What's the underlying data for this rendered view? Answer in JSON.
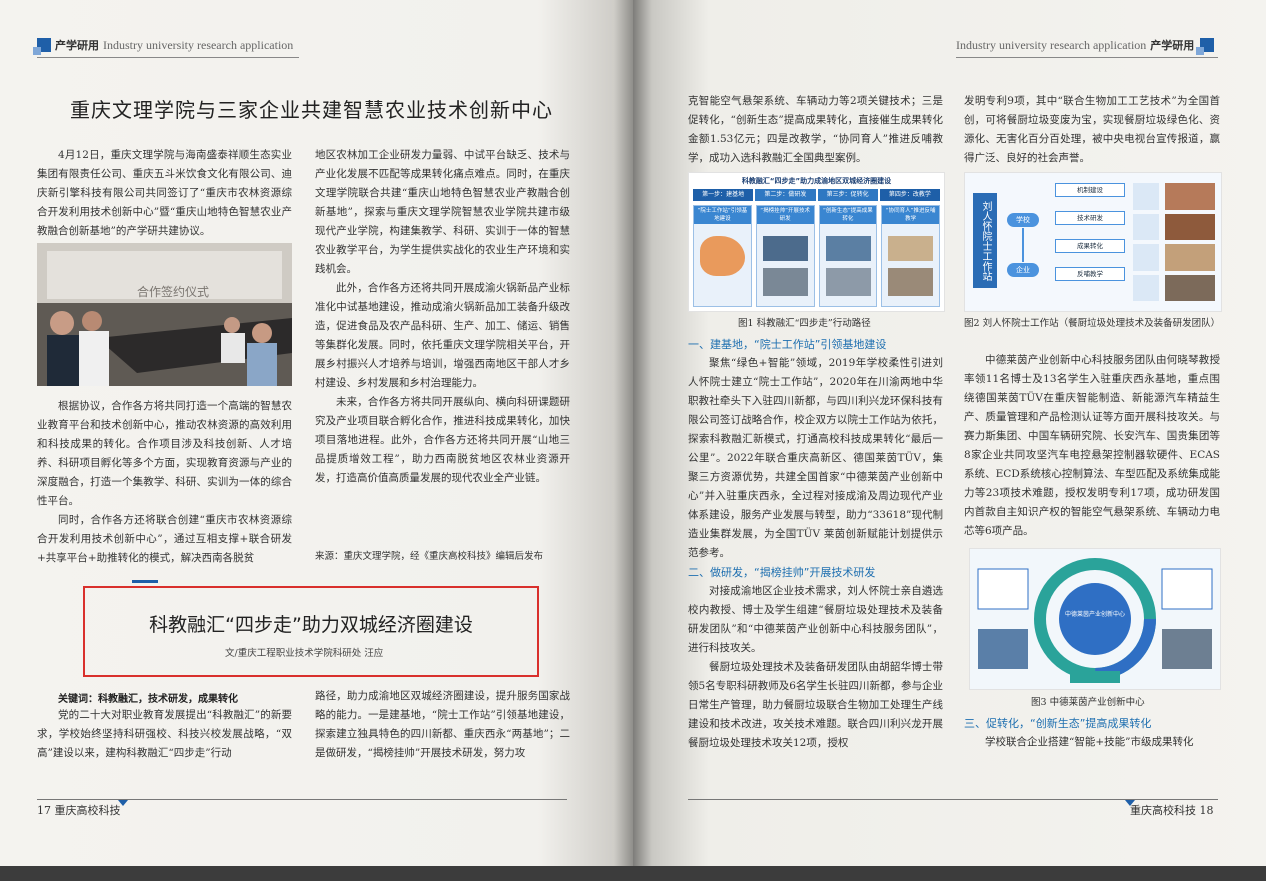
{
  "header_left": {
    "cn": "产学研用",
    "en": "Industry university research application"
  },
  "header_right": {
    "cn": "产学研用",
    "en": "Industry university research application"
  },
  "article1": {
    "title": "重庆文理学院与三家企业共建智慧农业技术创新中心",
    "col1_p1": "4月12日，重庆文理学院与海南盛泰祥顺生态实业集团有限责任公司、重庆五斗米饮食文化有限公司、迪庆新引擎科技有限公司共同签订了“重庆市农林资源综合开发利用技术创新中心”暨“重庆山地特色智慧农业产教融合创新基地”的产学研共建协议。",
    "photo_banner": "合作签约仪式",
    "col1_p2": "根据协议，合作各方将共同打造一个高端的智慧农业教育平台和技术创新中心，推动农林资源的高效利用和科技成果的转化。合作项目涉及科技创新、人才培养、科研项目孵化等多个方面，实现教育资源与产业的深度融合，打造一个集教学、科研、实训为一体的综合性平台。",
    "col1_p3": "同时，合作各方还将联合创建“重庆市农林资源综合开发利用技术创新中心”，通过互相支撑+联合研发+共享平台+助推转化的模式，解决西南各脱贫",
    "col2_p1": "地区农林加工企业研发力量弱、中试平台缺乏、技术与产业化发展不匹配等成果转化痛点难点。同时，在重庆文理学院联合共建“重庆山地特色智慧农业产教融合创新基地”，探索与重庆文理学院智慧农业学院共建市级现代产业学院，构建集教学、科研、实训于一体的智慧农业教学平台，为学生提供实战化的农业生产环境和实践机会。",
    "col2_p2": "此外，合作各方还将共同开展成渝火锅新品产业标准化中试基地建设，推动成渝火锅新品加工装备升级改造，促进食品及农产品科研、生产、加工、储运、销售等集群化发展。同时，依托重庆文理学院相关平台，开展乡村振兴人才培养与培训，增强西南地区干部人才乡村建设、乡村发展和乡村治理能力。",
    "col2_p3": "未来，合作各方将共同开展纵向、横向科研课题研究及产业项目联合孵化合作，推进科技成果转化，加快项目落地进程。此外，合作各方还将共同开展“山地三品提质增效工程”，助力西南脱贫地区农林业资源开发，打造高价值高质量发展的现代农业全产业链。",
    "source": "来源：重庆文理学院，经《重庆高校科技》编辑后发布"
  },
  "article2": {
    "title": "科教融汇“四步走”助力双城经济圈建设",
    "byline": "文/重庆工程职业技术学院科研处 汪应",
    "keywords": "关键词：科教融汇，技术研发，成果转化",
    "col1_p1": "党的二十大对职业教育发展提出“科教融汇”的新要求，学校始终坚持科研强校、科技兴校发展战略，“双高”建设以来，建构科教融汇“四步走”行动",
    "col2_p1": "路径，助力成渝地区双城经济圈建设，提升服务国家战略的能力。一是建基地，“院士工作站”引领基地建设，探索建立独具特色的四川新都、重庆西永“两基地”；二是做研发，“揭榜挂帅”开展技术研发，努力攻",
    "r1_p1": "克智能空气悬架系统、车辆动力等2项关键技术；三是促转化，“创新生态”提高成果转化，直接催生成果转化金额1.53亿元；四是改教学，“协同育人”推进反哺教学，成功入选科教融汇全国典型案例。",
    "fig1_title": "科教融汇“四步走”助力成渝地区双城经济圈建设",
    "fig1_steps": [
      "第一步：建基地",
      "第二步：做研发",
      "第三步：促转化",
      "第四步：改教学"
    ],
    "fig1_cards": [
      "“院士工作站”引领基地建设",
      "“揭榜挂帅”开展技术研发",
      "“创新生态”提高成果转化",
      "“协同育人”推进反哺教学"
    ],
    "fig1_caption": "图1  科教融汇“四步走”行动路径",
    "sec1": "一、建基地，“院士工作站”引领基地建设",
    "r1_p2": "聚焦“绿色+智能”领域，2019年学校柔性引进刘人怀院士建立“院士工作站”，2020年在川渝两地中华职教社牵头下入驻四川新都，与四川利兴龙环保科技有限公司签订战略合作，校企双方以院士工作站为依托，探索科教融汇新模式，打通高校科技成果转化“最后一公里”。2022年联合重庆高新区、德国莱茵TÜV，集聚三方资源优势，共建全国首家“中德莱茵产业创新中心”并入驻重庆西永，全过程对接成渝及周边现代产业体系建设，服务产业发展与转型，助力“33618”现代制造业集群发展，为全国TÜV 莱茵创新赋能计划提供示范参考。",
    "sec2": "二、做研发，“揭榜挂帅”开展技术研发",
    "r1_p3": "对接成渝地区企业技术需求，刘人怀院士亲自遴选校内教授、博士及学生组建“餐厨垃圾处理技术及装备研发团队”和“中德莱茵产业创新中心科技服务团队”，进行科技攻关。",
    "r1_p4": "餐厨垃圾处理技术及装备研发团队由胡韶华博士带领5名专职科研教师及6名学生长驻四川新都，参与企业日常生产管理，助力餐厨垃圾联合生物加工处理生产线建设和技术改进，攻关技术难题。联合四川利兴龙开展餐厨垃圾处理技术攻关12项，授权",
    "r2_p1": "发明专利9项，其中“联合生物加工工艺技术”为全国首创，可将餐厨垃圾变废为宝，实现餐厨垃圾绿色化、资源化、无害化百分百处理，被中央电视台宣传报道，赢得广泛、良好的社会声誉。",
    "fig2_station": "刘人怀院士工作站",
    "fig2_nodes": [
      "学校",
      "企业"
    ],
    "fig2_items": [
      "机制建设",
      "技术研发",
      "成果转化",
      "反哺教学"
    ],
    "fig2_caption": "图2  刘人怀院士工作站（餐厨垃圾处理技术及装备研发团队）",
    "r2_p2": "中德莱茵产业创新中心科技服务团队由何晓琴教授率领11名博士及13名学生入驻重庆西永基地，重点围绕德国莱茵TÜV在重庆智能制造、新能源汽车精益生产、质量管理和产品检测认证等方面开展科技攻关。与赛力斯集团、中国车辆研究院、长安汽车、国贵集团等8家企业共同攻坚汽车电控悬架控制器软硬件、ECAS系统、ECD系统核心控制算法、车型匹配及系统集成能力等23项技术难题，授权发明专利17项，成功研发国内首款自主知识产权的智能空气悬架系统、车辆动力电芯等6项产品。",
    "fig3_center": "中德莱茵产业创新中心",
    "fig3_caption": "图3  中德莱茵产业创新中心",
    "sec3": "三、促转化，“创新生态”提高成果转化",
    "r2_p3": "学校联合企业搭建“智能+技能”市级成果转化"
  },
  "footer_left": "17 重庆高校科技",
  "footer_right": "重庆高校科技  18",
  "colors": {
    "accent_blue": "#1e6fb0",
    "brand_blue": "#1f5fa8",
    "highlight_red": "#d9302c"
  }
}
